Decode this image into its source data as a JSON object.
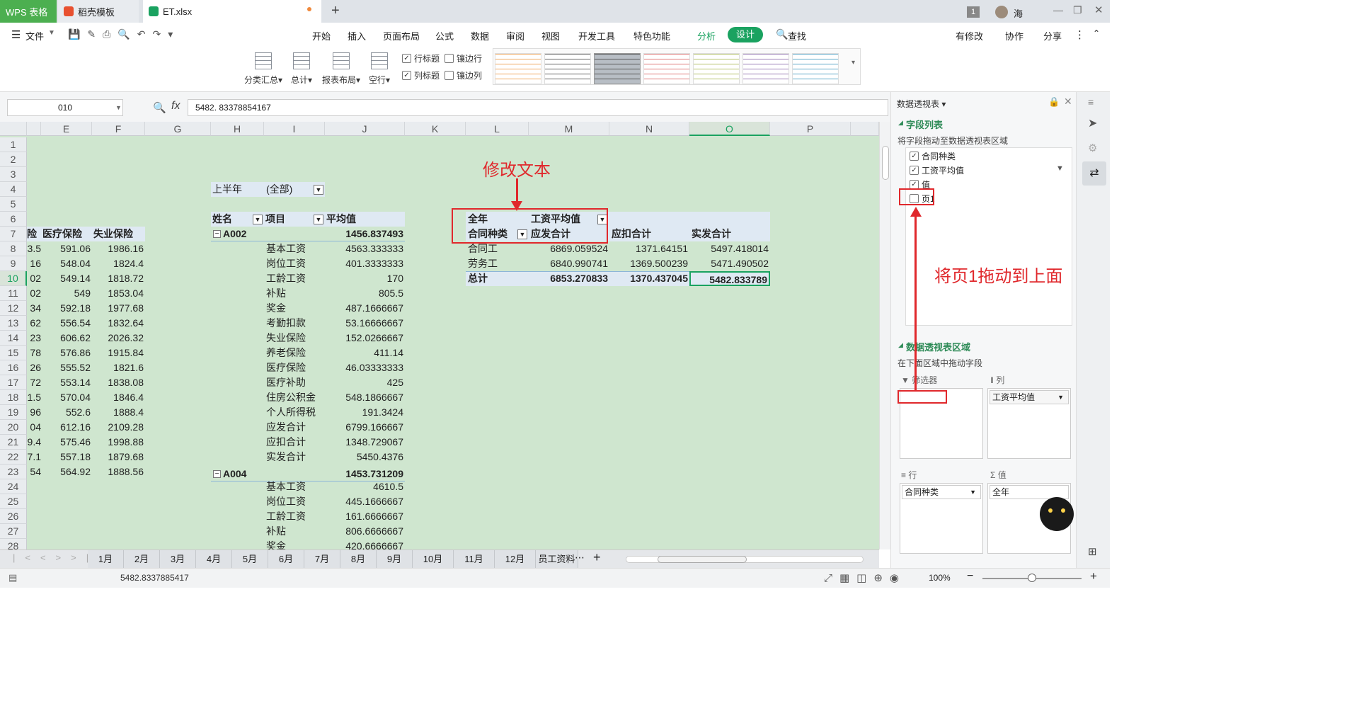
{
  "tabs": {
    "app": "WPS 表格",
    "template": "稻壳模板",
    "file": "ET.xlsx",
    "new": "+",
    "badge": "1",
    "user": "海"
  },
  "menu": {
    "file": "文件",
    "items": [
      "开始",
      "插入",
      "页面布局",
      "公式",
      "数据",
      "审阅",
      "视图",
      "开发工具",
      "特色功能",
      "分析",
      "设计"
    ],
    "search": "查找",
    "modified": "有修改",
    "collab": "协作",
    "share": "分享"
  },
  "ribbon": {
    "buttons": [
      "分类汇总",
      "总计",
      "报表布局",
      "空行"
    ],
    "checks": [
      {
        "label": "行标题",
        "checked": true
      },
      {
        "label": "镶边行",
        "checked": false
      },
      {
        "label": "列标题",
        "checked": true
      },
      {
        "label": "镶边列",
        "checked": false
      }
    ]
  },
  "formula": {
    "name_box": "010",
    "fx": "fx",
    "value": "5482. 83378854167"
  },
  "columns": [
    "E",
    "F",
    "G",
    "H",
    "I",
    "J",
    "K",
    "L",
    "M",
    "N",
    "O",
    "P"
  ],
  "rows": [
    "1",
    "2",
    "3",
    "4",
    "5",
    "6",
    "7",
    "8",
    "9",
    "10",
    "11",
    "12",
    "13",
    "14",
    "15",
    "16",
    "17",
    "18",
    "19",
    "20",
    "21",
    "22",
    "23",
    "24",
    "25",
    "26",
    "27",
    "28"
  ],
  "left_table": {
    "headers": [
      "险",
      "医疗保险",
      "失业保险"
    ],
    "rows": [
      [
        "3.5",
        "591.06",
        "1986.16"
      ],
      [
        "16",
        "548.04",
        "1824.4"
      ],
      [
        "02",
        "549.14",
        "1818.72"
      ],
      [
        "02",
        "549",
        "1853.04"
      ],
      [
        "34",
        "592.18",
        "1977.68"
      ],
      [
        "62",
        "556.54",
        "1832.64"
      ],
      [
        "23",
        "606.62",
        "2026.32"
      ],
      [
        "78",
        "576.86",
        "1915.84"
      ],
      [
        "26",
        "555.52",
        "1821.6"
      ],
      [
        "72",
        "553.14",
        "1838.08"
      ],
      [
        "1.5",
        "570.04",
        "1846.4"
      ],
      [
        "96",
        "552.6",
        "1888.4"
      ],
      [
        "04",
        "612.16",
        "2109.28"
      ],
      [
        "9.4",
        "575.46",
        "1998.88"
      ],
      [
        "7.1",
        "557.18",
        "1879.68"
      ],
      [
        "54",
        "564.92",
        "1888.56"
      ]
    ]
  },
  "pivot1": {
    "filter_label": "上半年",
    "filter_value": "(全部)",
    "headers": [
      "姓名",
      "项目",
      "平均值"
    ],
    "group1": {
      "name": "A002",
      "total": "1456.837493"
    },
    "items1": [
      [
        "基本工资",
        "4563.333333"
      ],
      [
        "岗位工资",
        "401.3333333"
      ],
      [
        "工龄工资",
        "170"
      ],
      [
        "补贴",
        "805.5"
      ],
      [
        "奖金",
        "487.1666667"
      ],
      [
        "考勤扣款",
        "53.16666667"
      ],
      [
        "失业保险",
        "152.0266667"
      ],
      [
        "养老保险",
        "411.14"
      ],
      [
        "医疗保险",
        "46.03333333"
      ],
      [
        "医疗补助",
        "425"
      ],
      [
        "住房公积金",
        "548.1866667"
      ],
      [
        "个人所得税",
        "191.3424"
      ],
      [
        "应发合计",
        "6799.166667"
      ],
      [
        "应扣合计",
        "1348.729067"
      ],
      [
        "实发合计",
        "5450.4376"
      ]
    ],
    "group2": {
      "name": "A004",
      "total": "1453.731209"
    },
    "items2": [
      [
        "基本工资",
        "4610.5"
      ],
      [
        "岗位工资",
        "445.1666667"
      ],
      [
        "工龄工资",
        "161.6666667"
      ],
      [
        "补贴",
        "806.6666667"
      ],
      [
        "奖金",
        "420.6666667"
      ]
    ]
  },
  "pivot2": {
    "filter_label": "全年",
    "filter_value": "工资平均值",
    "headers": [
      "合同种类",
      "应发合计",
      "应扣合计",
      "实发合计"
    ],
    "rows": [
      [
        "合同工",
        "6869.059524",
        "1371.64151",
        "5497.418014"
      ],
      [
        "劳务工",
        "6840.990741",
        "1369.500239",
        "5471.490502"
      ]
    ],
    "total": [
      "总计",
      "6853.270833",
      "1370.437045",
      "5482.833789"
    ]
  },
  "annotations": {
    "edit_text": "修改文本",
    "drag_hint": "将页1拖动到上面"
  },
  "sheet_tabs": [
    "1月",
    "2月",
    "3月",
    "4月",
    "5月",
    "6月",
    "7月",
    "8月",
    "9月",
    "10月",
    "11月",
    "12月",
    "员工资料"
  ],
  "status": {
    "value": "5482.8337885417",
    "zoom": "100%"
  },
  "panel": {
    "title": "数据透视表",
    "field_list_title": "字段列表",
    "field_hint": "将字段拖动至数据透视表区域",
    "fields": [
      {
        "label": "合同种类",
        "checked": true
      },
      {
        "label": "工资平均值",
        "checked": true
      },
      {
        "label": "值",
        "checked": true
      },
      {
        "label": "页1",
        "checked": false
      }
    ],
    "area_title": "数据透视表区域",
    "area_hint": "在下面区域中拖动字段",
    "filter_label": "筛选器",
    "col_label": "列",
    "row_label": "行",
    "val_label": "值",
    "col_item": "工资平均值",
    "row_item": "合同种类",
    "val_item": "全年"
  }
}
